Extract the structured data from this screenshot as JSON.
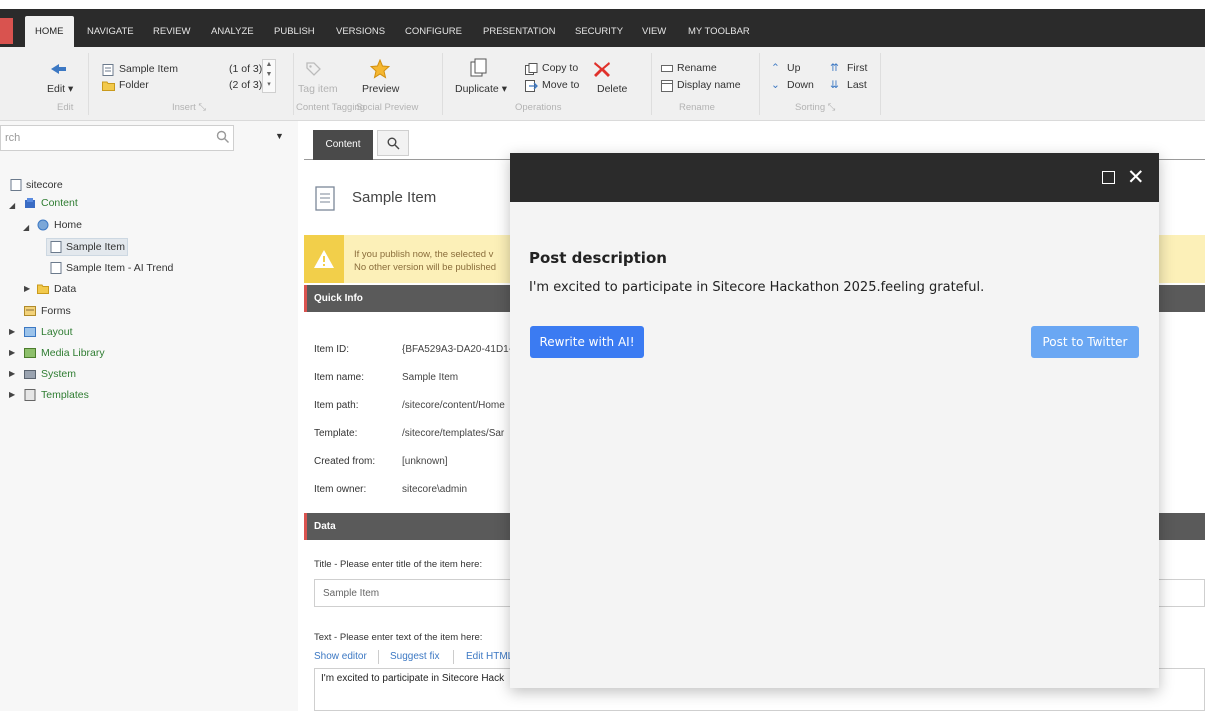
{
  "tabs": {
    "home": "HOME",
    "navigate": "NAVIGATE",
    "review": "REVIEW",
    "analyze": "ANALYZE",
    "publish": "PUBLISH",
    "versions": "VERSIONS",
    "configure": "CONFIGURE",
    "presentation": "PRESENTATION",
    "security": "SECURITY",
    "view": "VIEW",
    "my_toolbar": "MY TOOLBAR"
  },
  "ribbon": {
    "edit_label": "Edit",
    "edit_group": "Edit",
    "insert_item1": "Sample Item",
    "insert_item1_count": "(1 of 3)",
    "insert_item2": "Folder",
    "insert_item2_count": "(2 of 3)",
    "insert_group": "Insert",
    "tag_item": "Tag item",
    "preview": "Preview",
    "content_tagging_group": "Content Tagging",
    "social_preview_group": "Social Preview",
    "duplicate": "Duplicate",
    "copy_to": "Copy to",
    "move_to": "Move to",
    "delete": "Delete",
    "operations_group": "Operations",
    "rename": "Rename",
    "display_name": "Display name",
    "rename_group": "Rename",
    "up": "Up",
    "down": "Down",
    "first": "First",
    "last": "Last",
    "sorting_group": "Sorting"
  },
  "sidebar": {
    "search_placeholder": "rch",
    "tree": {
      "sitecore": "sitecore",
      "content": "Content",
      "home": "Home",
      "sample_item": "Sample Item",
      "sample_item_ai": "Sample Item - AI Trend",
      "data": "Data",
      "forms": "Forms",
      "layout": "Layout",
      "media_library": "Media Library",
      "system": "System",
      "templates": "Templates"
    }
  },
  "content": {
    "tab_label": "Content",
    "item_title": "Sample Item",
    "warning_line1": "If you publish now, the selected v",
    "warning_line2": "No other version will be published",
    "quick_info_title": "Quick Info",
    "fields": {
      "item_id_label": "Item ID:",
      "item_id_value": "{BFA529A3-DA20-41D1-",
      "item_name_label": "Item name:",
      "item_name_value": "Sample Item",
      "item_path_label": "Item path:",
      "item_path_value": "/sitecore/content/Home",
      "template_label": "Template:",
      "template_value": "/sitecore/templates/Sar",
      "created_from_label": "Created from:",
      "created_from_value": "[unknown]",
      "item_owner_label": "Item owner:",
      "item_owner_value": "sitecore\\admin"
    },
    "data_title": "Data",
    "title_field_label": "Title - Please enter title of the item here:",
    "title_field_value": "Sample Item",
    "text_field_label": "Text - Please enter text of the item here:",
    "show_editor": "Show editor",
    "suggest_fix": "Suggest fix",
    "edit_html": "Edit HTML",
    "text_field_value": "I'm excited to participate in Sitecore Hack"
  },
  "modal": {
    "heading": "Post description",
    "body": "I'm excited to participate in Sitecore Hackathon 2025.feeling grateful.",
    "rewrite_button": "Rewrite with AI!",
    "twitter_button": "Post to Twitter"
  },
  "colors": {
    "dark_bar": "#2b2b2b",
    "accent_red": "#d9534f",
    "primary_blue": "#3b7bf2",
    "light_blue": "#6aa7f3",
    "warning_yellow": "#fcf0b8"
  }
}
